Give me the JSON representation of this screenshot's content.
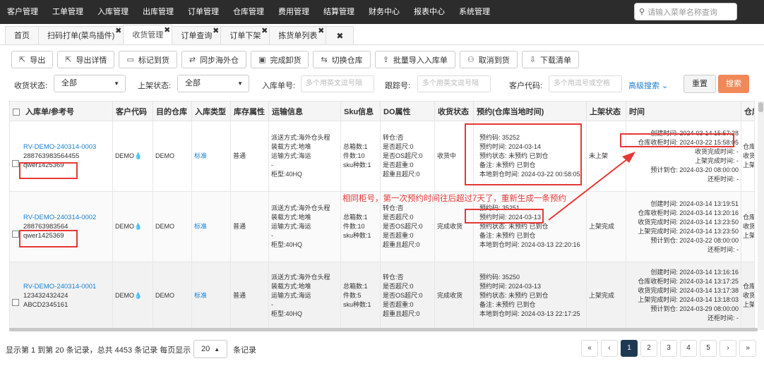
{
  "nav": {
    "menu": [
      "客户管理",
      "工单管理",
      "入库管理",
      "出库管理",
      "订单管理",
      "仓库管理",
      "费用管理",
      "结算管理",
      "财务中心",
      "报表中心",
      "系统管理"
    ],
    "search_placeholder": "请输入菜单名称查询"
  },
  "tabs": [
    {
      "label": "首页",
      "close": ""
    },
    {
      "label": "扫码打单(菜鸟插件)",
      "close": "✖"
    },
    {
      "label": "收货管理",
      "close": "✖"
    },
    {
      "label": "订单查询",
      "close": "✖"
    },
    {
      "label": "订单下架",
      "close": "✖"
    },
    {
      "label": "拣货单列表",
      "close": "✖"
    },
    {
      "label": "✖",
      "close": ""
    }
  ],
  "toolbar": [
    "导出",
    "导出详情",
    "标记到货",
    "同步海外仓",
    "完成卸货",
    "切换仓库",
    "批量导入入库单",
    "取消到货",
    "下载清单"
  ],
  "filters": {
    "status_label": "收货状态:",
    "status_value": "全部",
    "shelf_label": "上架状态:",
    "shelf_value": "全部",
    "inbound_label": "入库单号:",
    "inbound_placeholder": "多个用英文逗号隔",
    "track_label": "跟踪号:",
    "track_placeholder": "多个用英文逗号隔",
    "cust_label": "客户代码:",
    "cust_placeholder": "多个用逗号或空格",
    "advanced": "高级搜索",
    "reset": "重置",
    "search": "搜索"
  },
  "columns": [
    "入库单/参考号",
    "客户代码",
    "目的仓库",
    "入库类型",
    "库存属性",
    "运输信息",
    "Sku信息",
    "DO属性",
    "收货状态",
    "预约(仓库当地时间)",
    "上架状态",
    "时间",
    "仓库"
  ],
  "rows": [
    {
      "order_no": "RV-DEMO-240314-0003",
      "ref1": "288763983564455",
      "ref2": "qwer1425369",
      "customer": "DEMO",
      "warehouse": "DEMO",
      "type": "标准",
      "attr": "普通",
      "transport": [
        "派送方式:海外仓头程",
        "装载方式:地堆",
        "运输方式:海运",
        "-",
        "柜型:40HQ"
      ],
      "sku": [
        "总箱数:1",
        "件数:10",
        "sku种数:1"
      ],
      "do": [
        "转仓:否",
        "是否超尺:0",
        "是否OS超尺:0",
        "是否超重:0",
        "超重且超尺:0"
      ],
      "recv": "收货中",
      "appt": [
        "预约码: 35252",
        "预约时间: 2024-03-14",
        "预约状态: 未预约 已到仓",
        "备注: 未预约 已到仓",
        "本地到仓时间: 2024-03-22 00:58:05"
      ],
      "shelf": "未上架",
      "times": [
        "创建时间: 2024-03-14 15:57:28",
        "仓库收柜时间: 2024-03-22 15:58:05",
        "收货完成时间: -",
        "上架完成时间: -",
        "预计到仓: 2024-03-20 08:00:00",
        "还柜时间: -"
      ],
      "extra": [
        "仓库",
        "收货",
        "上架"
      ]
    },
    {
      "order_no": "RV-DEMO-240314-0002",
      "ref1": "288763983564",
      "ref2": "qwer1425369",
      "customer": "DEMO",
      "warehouse": "DEMO",
      "type": "标准",
      "attr": "普通",
      "transport": [
        "派送方式:海外仓头程",
        "装载方式:地堆",
        "运输方式:海运",
        "-",
        "柜型:40HQ"
      ],
      "sku": [
        "总箱数:1",
        "件数:10",
        "sku种数:1"
      ],
      "do": [
        "转仓:否",
        "是否超尺:0",
        "是否OS超尺:0",
        "是否超重:0",
        "超重且超尺:0"
      ],
      "recv": "完成收货",
      "appt": [
        "预约码: 35251",
        "预约时间: 2024-03-13",
        "预约状态: 未预约 已到仓",
        "备注: 未预约 已到仓",
        "本地到仓时间: 2024-03-13 22:20:16"
      ],
      "shelf": "上架完成",
      "times": [
        "创建时间: 2024-03-14 13:19:51",
        "仓库收柜时间: 2024-03-14 13:20:16",
        "收货完成时间: 2024-03-14 13:23:50",
        "上架完成时间: 2024-03-14 13:23:50",
        "预计到仓: 2024-03-22 08:00:00",
        "还柜时间: -"
      ],
      "extra": [
        "仓库",
        "收货",
        "上架"
      ]
    },
    {
      "order_no": "RV-DEMO-240314-0001",
      "ref1": "123432432424",
      "ref2": "ABCD2345161",
      "customer": "DEMO",
      "warehouse": "DEMO",
      "type": "标准",
      "attr": "普通",
      "transport": [
        "派送方式:海外仓头程",
        "装载方式:地堆",
        "运输方式:海运",
        "-",
        "柜型:40HQ"
      ],
      "sku": [
        "总箱数:1",
        "件数:5",
        "sku种数:1"
      ],
      "do": [
        "转仓:否",
        "是否超尺:0",
        "是否OS超尺:0",
        "是否超重:0",
        "超重且超尺:0"
      ],
      "recv": "完成收货",
      "appt": [
        "预约码: 35250",
        "预约时间: 2024-03-13",
        "预约状态: 未预约 已到仓",
        "备注: 未预约 已到仓",
        "本地到仓时间: 2024-03-13 22:17:25"
      ],
      "shelf": "上架完成",
      "times": [
        "创建时间: 2024-03-14 13:16:16",
        "仓库收柜时间: 2024-03-14 13:17:25",
        "收货完成时间: 2024-03-14 13:17:38",
        "上架完成时间: 2024-03-14 13:18:03",
        "预计到仓: 2024-03-29 08:00:00",
        "还柜时间: -"
      ],
      "extra": [
        "仓库",
        "收货",
        "上架"
      ]
    }
  ],
  "annotation": "相同柜号，第一次预约时间往后超过7天了，重新生成一条预约",
  "footer": {
    "summary": "显示第 1 到第 20 条记录，总共 4453 条记录 每页显示",
    "page_size": "20",
    "suffix": "条记录",
    "pages": [
      "«",
      "‹",
      "1",
      "2",
      "3",
      "4",
      "5",
      "›",
      "»"
    ]
  }
}
